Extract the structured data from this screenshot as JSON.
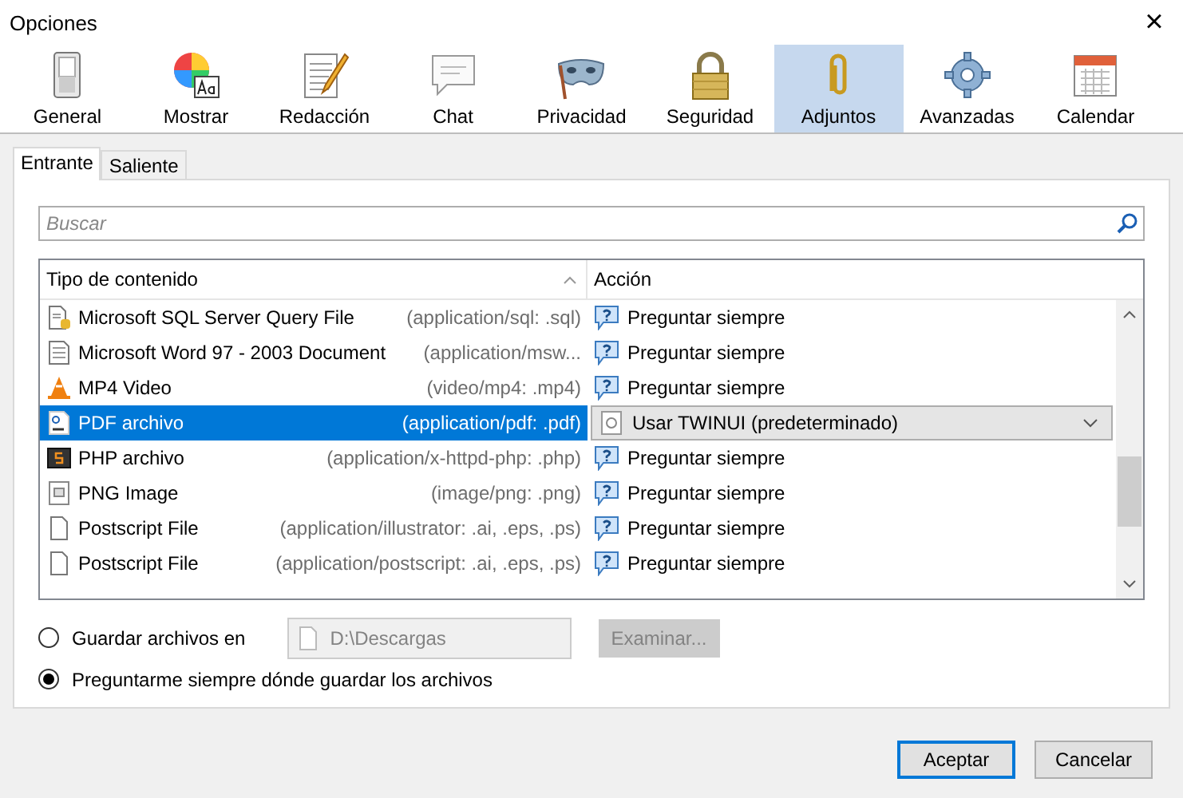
{
  "window": {
    "title": "Opciones",
    "close": "×"
  },
  "toolbar": [
    {
      "label": "General",
      "selected": false
    },
    {
      "label": "Mostrar",
      "selected": false
    },
    {
      "label": "Redacción",
      "selected": false
    },
    {
      "label": "Chat",
      "selected": false
    },
    {
      "label": "Privacidad",
      "selected": false
    },
    {
      "label": "Seguridad",
      "selected": false
    },
    {
      "label": "Adjuntos",
      "selected": true
    },
    {
      "label": "Avanzadas",
      "selected": false
    },
    {
      "label": "Calendar",
      "selected": false
    }
  ],
  "subtabs": [
    {
      "label": "Entrante",
      "selected": true
    },
    {
      "label": "Saliente",
      "selected": false
    }
  ],
  "search": {
    "placeholder": "Buscar"
  },
  "table": {
    "columns": [
      "Tipo de contenido",
      "Acción"
    ],
    "rows": [
      {
        "name": "Microsoft SQL Server Query File",
        "type": "(application/sql: .sql)",
        "action": "Preguntar siempre",
        "selected": false
      },
      {
        "name": "Microsoft Word 97 - 2003 Document",
        "type": "(application/msw...",
        "action": "Preguntar siempre",
        "selected": false
      },
      {
        "name": "MP4 Video",
        "type": "(video/mp4: .mp4)",
        "action": "Preguntar siempre",
        "selected": false
      },
      {
        "name": "PDF archivo",
        "type": "(application/pdf: .pdf)",
        "action": "Usar TWINUI (predeterminado)",
        "selected": true
      },
      {
        "name": "PHP archivo",
        "type": "(application/x-httpd-php: .php)",
        "action": "Preguntar siempre",
        "selected": false
      },
      {
        "name": "PNG Image",
        "type": "(image/png: .png)",
        "action": "Preguntar siempre",
        "selected": false
      },
      {
        "name": "Postscript File",
        "type": "(application/illustrator: .ai, .eps, .ps)",
        "action": "Preguntar siempre",
        "selected": false
      },
      {
        "name": "Postscript File",
        "type": "(application/postscript: .ai, .eps, .ps)",
        "action": "Preguntar siempre",
        "selected": false
      }
    ]
  },
  "save_options": [
    {
      "label": "Guardar archivos en",
      "selected": false,
      "folder": "D:\\Descargas",
      "browse": "Examinar...",
      "disabled": true
    },
    {
      "label": "Preguntarme siempre dónde guardar los archivos",
      "selected": true
    }
  ],
  "buttons": [
    {
      "label": "Aceptar",
      "default": true
    },
    {
      "label": "Cancelar",
      "default": false
    }
  ]
}
